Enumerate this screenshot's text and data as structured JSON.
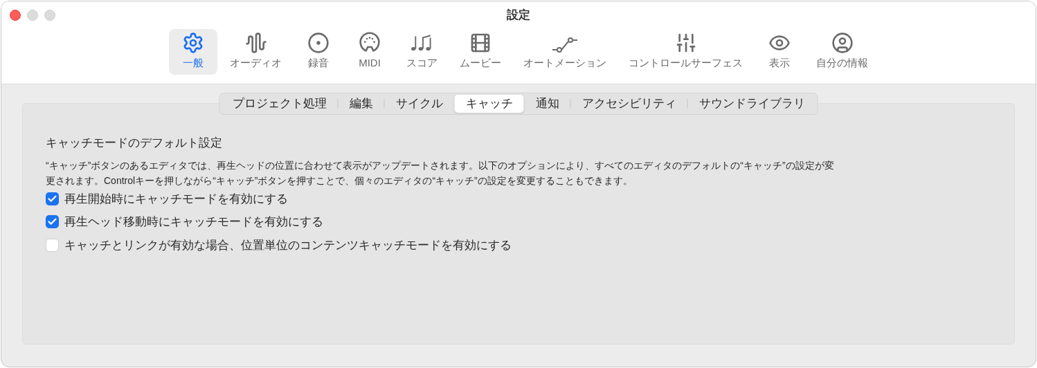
{
  "window": {
    "title": "設定"
  },
  "toolbar": [
    {
      "kind": "general",
      "label": "一般",
      "selected": true
    },
    {
      "kind": "audio",
      "label": "オーディオ",
      "selected": false
    },
    {
      "kind": "record",
      "label": "録音",
      "selected": false
    },
    {
      "kind": "midi",
      "label": "MIDI",
      "selected": false
    },
    {
      "kind": "score",
      "label": "スコア",
      "selected": false
    },
    {
      "kind": "movie",
      "label": "ムービー",
      "selected": false
    },
    {
      "kind": "automation",
      "label": "オートメーション",
      "selected": false
    },
    {
      "kind": "surface",
      "label": "コントロールサーフェス",
      "selected": false
    },
    {
      "kind": "display",
      "label": "表示",
      "selected": false
    },
    {
      "kind": "user",
      "label": "自分の情報",
      "selected": false
    }
  ],
  "tabs": [
    {
      "label": "プロジェクト処理",
      "selected": false
    },
    {
      "label": "編集",
      "selected": false
    },
    {
      "label": "サイクル",
      "selected": false
    },
    {
      "label": "キャッチ",
      "selected": true
    },
    {
      "label": "通知",
      "selected": false
    },
    {
      "label": "アクセシビリティ",
      "selected": false
    },
    {
      "label": "サウンドライブラリ",
      "selected": false
    }
  ],
  "section": {
    "title": "キャッチモードのデフォルト設定",
    "description": "“キャッチ”ボタンのあるエディタでは、再生ヘッドの位置に合わせて表示がアップデートされます。以下のオプションにより、すべてのエディタのデフォルトの“キャッチ”の設定が変更されます。Controlキーを押しながら“キャッチ”ボタンを押すことで、個々のエディタの“キャッチ”の設定を変更することもできます。",
    "options": [
      {
        "label": "再生開始時にキャッチモードを有効にする",
        "checked": true
      },
      {
        "label": "再生ヘッド移動時にキャッチモードを有効にする",
        "checked": true
      },
      {
        "label": "キャッチとリンクが有効な場合、位置単位のコンテンツキャッチモードを有効にする",
        "checked": false
      }
    ]
  }
}
